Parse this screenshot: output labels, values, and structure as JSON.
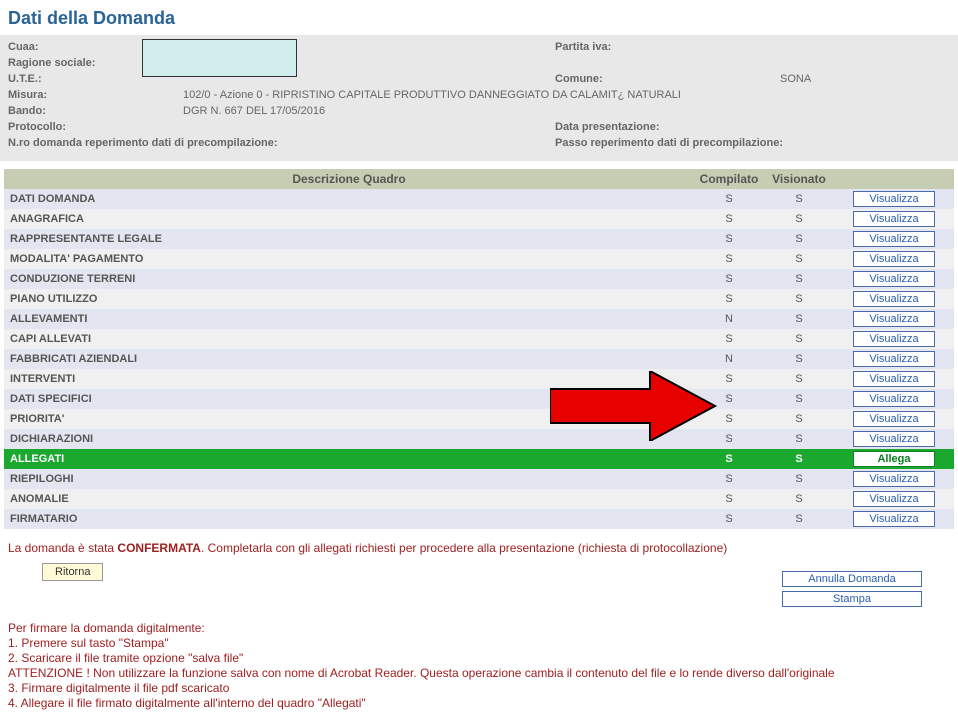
{
  "title": "Dati della Domanda",
  "header": {
    "cuaa_label": "Cuaa:",
    "ragione_label": "Ragione sociale:",
    "ute_label": "U.T.E.:",
    "misura_label": "Misura:",
    "misura_val": "102/0 - Azione 0 - RIPRISTINO CAPITALE PRODUTTIVO DANNEGGIATO DA CALAMIT¿ NATURALI",
    "bando_label": "Bando:",
    "bando_val": "DGR N. 667 DEL 17/05/2016",
    "protocollo_label": "Protocollo:",
    "precomp_label": "N.ro domanda reperimento dati di precompilazione:",
    "piva_label": "Partita iva:",
    "comune_label": "Comune:",
    "comune_val": "SONA",
    "datapres_label": "Data presentazione:",
    "passo_label": "Passo reperimento dati di precompilazione:"
  },
  "table_headers": {
    "desc": "Descrizione Quadro",
    "comp": "Compilato",
    "vis": "Visionato"
  },
  "rows": [
    {
      "desc": "DATI DOMANDA",
      "comp": "S",
      "vis": "S",
      "btn": "Visualizza"
    },
    {
      "desc": "ANAGRAFICA",
      "comp": "S",
      "vis": "S",
      "btn": "Visualizza"
    },
    {
      "desc": "RAPPRESENTANTE LEGALE",
      "comp": "S",
      "vis": "S",
      "btn": "Visualizza"
    },
    {
      "desc": "MODALITA' PAGAMENTO",
      "comp": "S",
      "vis": "S",
      "btn": "Visualizza"
    },
    {
      "desc": "CONDUZIONE TERRENI",
      "comp": "S",
      "vis": "S",
      "btn": "Visualizza"
    },
    {
      "desc": "PIANO UTILIZZO",
      "comp": "S",
      "vis": "S",
      "btn": "Visualizza"
    },
    {
      "desc": "ALLEVAMENTI",
      "comp": "N",
      "vis": "S",
      "btn": "Visualizza"
    },
    {
      "desc": "CAPI ALLEVATI",
      "comp": "S",
      "vis": "S",
      "btn": "Visualizza"
    },
    {
      "desc": "FABBRICATI AZIENDALI",
      "comp": "N",
      "vis": "S",
      "btn": "Visualizza"
    },
    {
      "desc": "INTERVENTI",
      "comp": "S",
      "vis": "S",
      "btn": "Visualizza"
    },
    {
      "desc": "DATI SPECIFICI",
      "comp": "S",
      "vis": "S",
      "btn": "Visualizza"
    },
    {
      "desc": "PRIORITA'",
      "comp": "S",
      "vis": "S",
      "btn": "Visualizza"
    },
    {
      "desc": "DICHIARAZIONI",
      "comp": "S",
      "vis": "S",
      "btn": "Visualizza"
    },
    {
      "desc": "ALLEGATI",
      "comp": "S",
      "vis": "S",
      "btn": "Allega",
      "highlight": true
    },
    {
      "desc": "RIEPILOGHI",
      "comp": "S",
      "vis": "S",
      "btn": "Visualizza"
    },
    {
      "desc": "ANOMALIE",
      "comp": "S",
      "vis": "S",
      "btn": "Visualizza"
    },
    {
      "desc": "FIRMATARIO",
      "comp": "S",
      "vis": "S",
      "btn": "Visualizza"
    }
  ],
  "status": {
    "pre": "La domanda è stata ",
    "bold": "CONFERMATA",
    "post": ". Completarla con gli allegati richiesti per procedere alla presentazione (richiesta di protocollazione)"
  },
  "btn_ritorna": "Ritorna",
  "btn_annulla": "Annulla Domanda",
  "btn_stampa": "Stampa",
  "instructions": {
    "intro": "Per firmare la domanda digitalmente:",
    "l1": "1. Premere sul tasto \"Stampa\"",
    "l2": "2. Scaricare il file tramite opzione \"salva file\"",
    "l3": "ATTENZIONE ! Non utilizzare la funzione salva con nome di Acrobat Reader. Questa operazione cambia il contenuto del file e lo rende diverso dall'originale",
    "l4": "3. Firmare digitalmente il file pdf scaricato",
    "l5": "4. Allegare il file firmato digitalmente all'interno del quadro \"Allegati\""
  }
}
